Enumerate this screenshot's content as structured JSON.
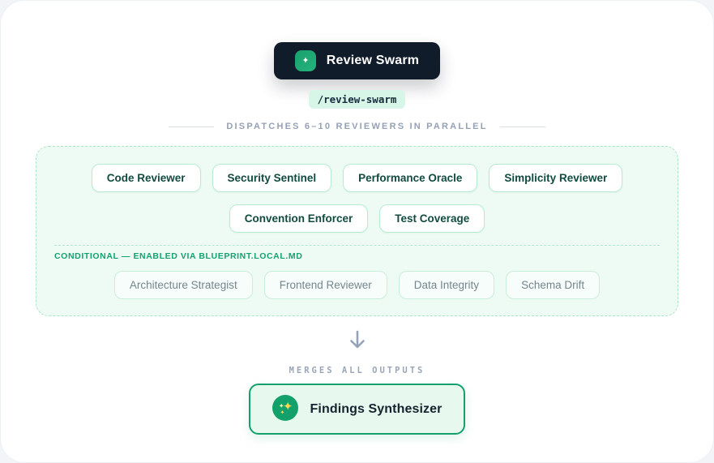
{
  "colors": {
    "accent_green": "#16a06d",
    "dark_navy": "#111c2b",
    "mint_panel": "#eefbf4",
    "muted_slate": "#94a3b8",
    "chip_text": "#124b3f",
    "conditional_green": "#12a371"
  },
  "header": {
    "command_title": "Review Swarm",
    "slash_command": "/review-swarm"
  },
  "dispatch": {
    "label": "DISPATCHES 6–10 REVIEWERS IN PARALLEL"
  },
  "reviewers": {
    "core": [
      "Code Reviewer",
      "Security Sentinel",
      "Performance Oracle",
      "Simplicity Reviewer",
      "Convention Enforcer",
      "Test Coverage"
    ],
    "conditional_label": "CONDITIONAL — ENABLED VIA BLUEPRINT.LOCAL.MD",
    "conditional": [
      "Architecture Strategist",
      "Frontend Reviewer",
      "Data Integrity",
      "Schema Drift"
    ]
  },
  "merge": {
    "label": "MERGES ALL OUTPUTS",
    "synthesizer_title": "Findings Synthesizer"
  }
}
